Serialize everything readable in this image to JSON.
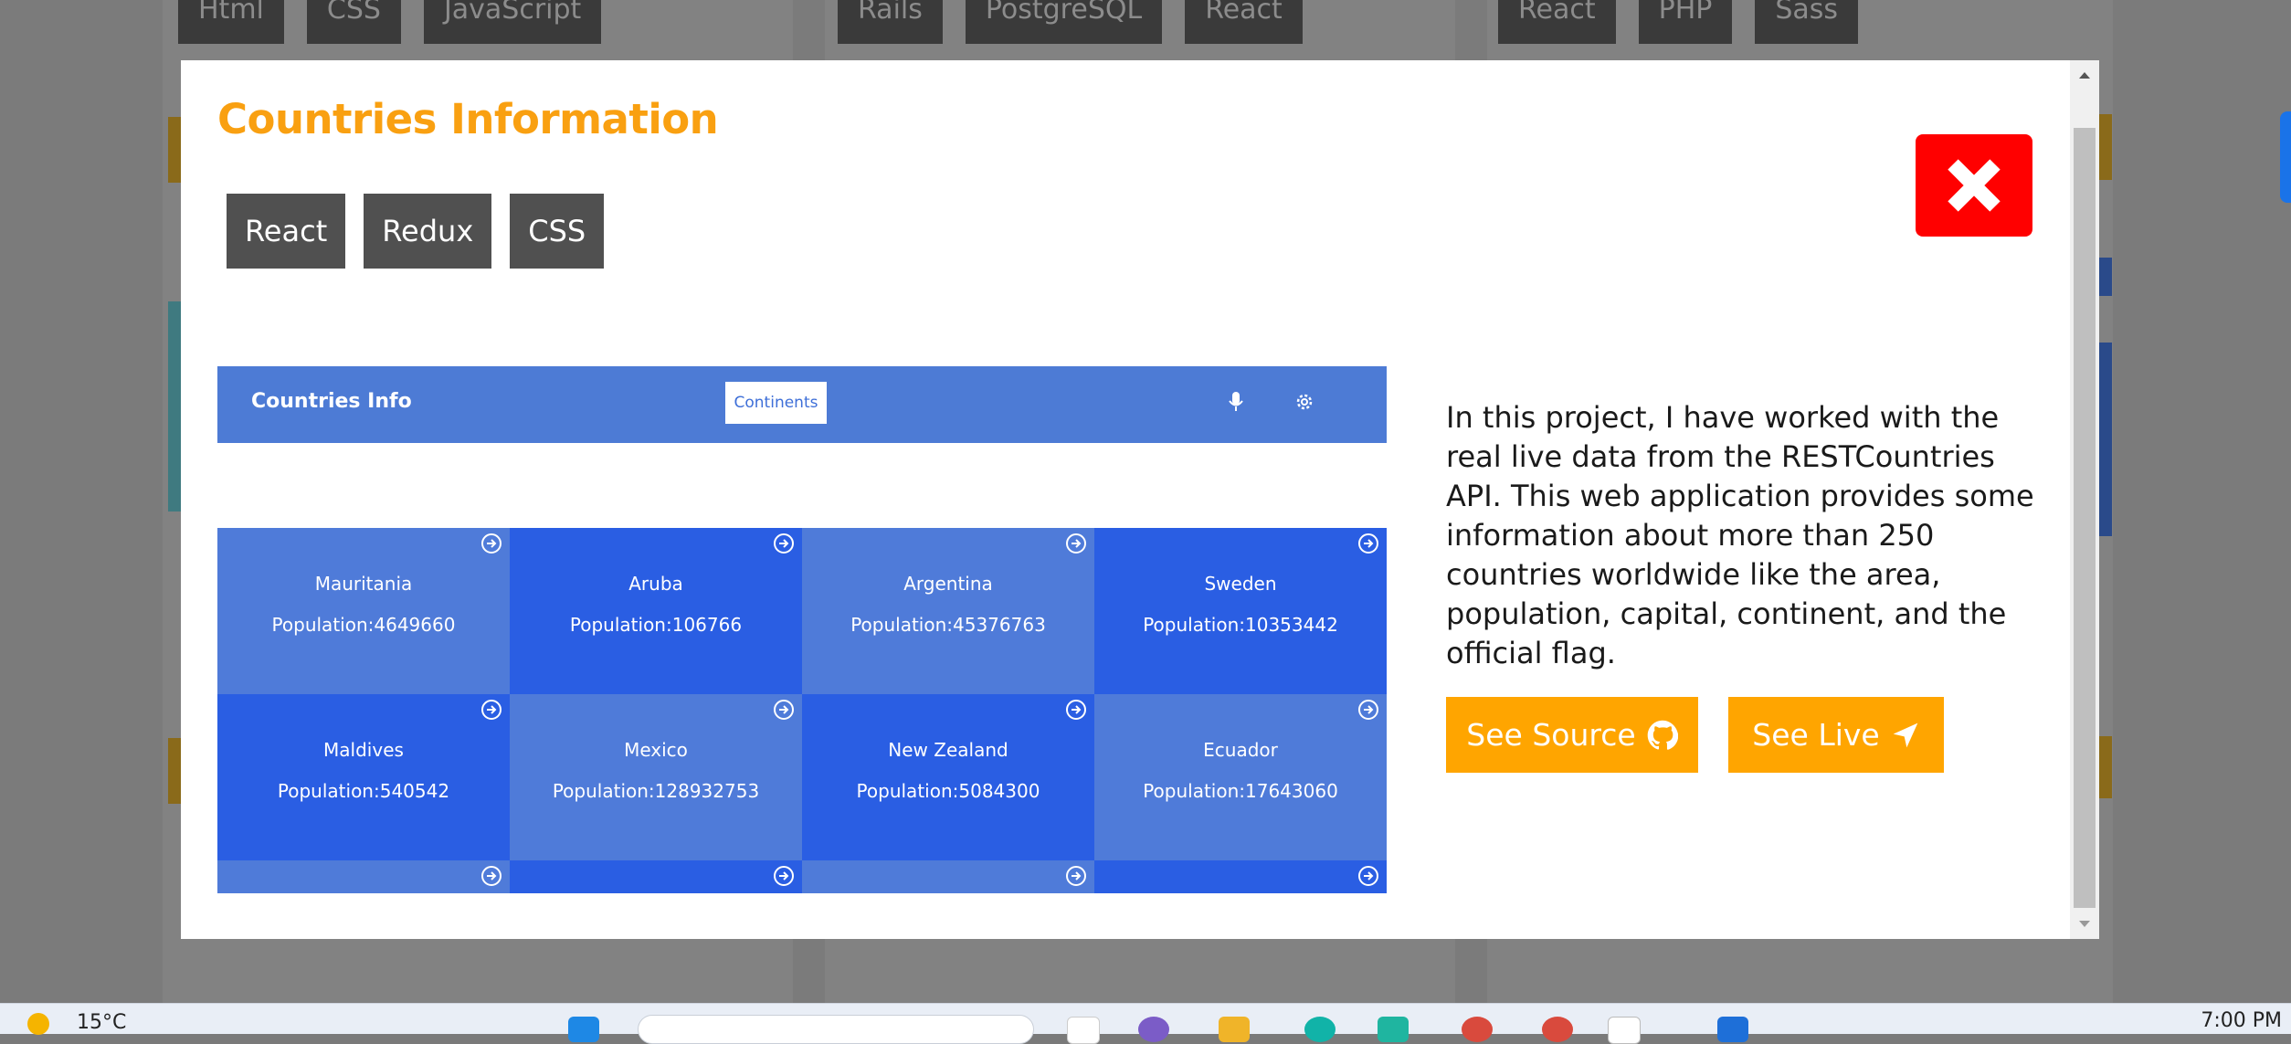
{
  "background": {
    "card_tags": [
      [
        "Html",
        "CSS",
        "JavaScript"
      ],
      [
        "Rails",
        "PostgreSQL",
        "React"
      ],
      [
        "React",
        "PHP",
        "Sass"
      ]
    ]
  },
  "modal": {
    "title": "Countries Information",
    "tags": [
      "React",
      "Redux",
      "CSS"
    ],
    "close_icon": "close-x-icon",
    "preview": {
      "brand": "Countries Info",
      "filter_label": "Continents",
      "icons": [
        "microphone-icon",
        "gear-icon"
      ],
      "countries": [
        {
          "name": "Mauritania",
          "population": "Population:4649660"
        },
        {
          "name": "Aruba",
          "population": "Population:106766"
        },
        {
          "name": "Argentina",
          "population": "Population:45376763"
        },
        {
          "name": "Sweden",
          "population": "Population:10353442"
        },
        {
          "name": "Maldives",
          "population": "Population:540542"
        },
        {
          "name": "Mexico",
          "population": "Population:128932753"
        },
        {
          "name": "New Zealand",
          "population": "Population:5084300"
        },
        {
          "name": "Ecuador",
          "population": "Population:17643060"
        },
        {
          "name": "",
          "population": ""
        },
        {
          "name": "",
          "population": ""
        },
        {
          "name": "",
          "population": ""
        },
        {
          "name": "",
          "population": ""
        }
      ]
    },
    "description": "In this project, I have worked with the real live data from the RESTCountries API. This web application provides some information about more than 250 countries worldwide like the area, population, capital, continent, and the official flag.",
    "buttons": {
      "source_label": "See Source",
      "source_icon": "github-icon",
      "live_label": "See Live",
      "live_icon": "location-arrow-icon"
    }
  },
  "taskbar": {
    "weather": "15°C",
    "clock": "7:00 PM"
  },
  "colors": {
    "accent": "#ffa500",
    "title": "#f9a011",
    "close": "#ff0000",
    "tag_bg": "#505050",
    "preview_nav": "#4d7bd5",
    "cell_light": "#4f7bd9",
    "cell_dark": "#2a5ee3"
  }
}
